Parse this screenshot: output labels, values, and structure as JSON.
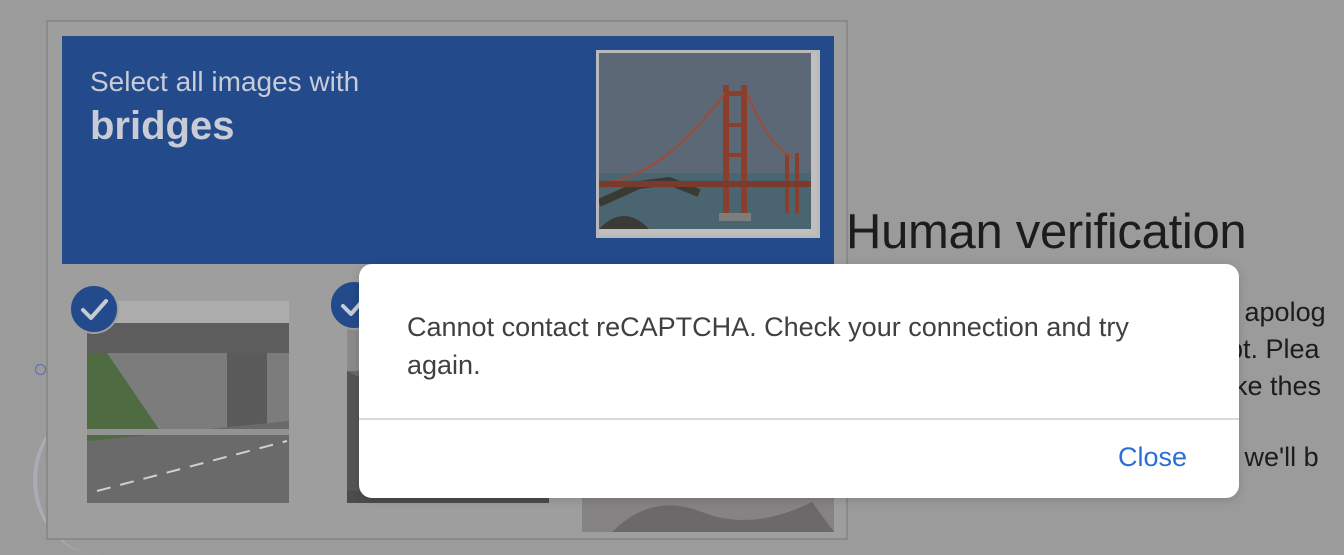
{
  "page": {
    "heading": "Human verification",
    "paragraph_fragments": [
      "e apolog",
      "ipt. Plea",
      "like thes",
      "d we'll b"
    ]
  },
  "challenge": {
    "prompt": "Select all images with",
    "object": "bridges",
    "tiles_selected": [
      true,
      true
    ]
  },
  "dialog": {
    "message": "Cannot contact reCAPTCHA. Check your connection and try again.",
    "close_label": "Close"
  },
  "colors": {
    "header_blue": "#234a8a",
    "link_blue": "#2b6fd6",
    "overlay_gray": "#9b9b9b"
  }
}
